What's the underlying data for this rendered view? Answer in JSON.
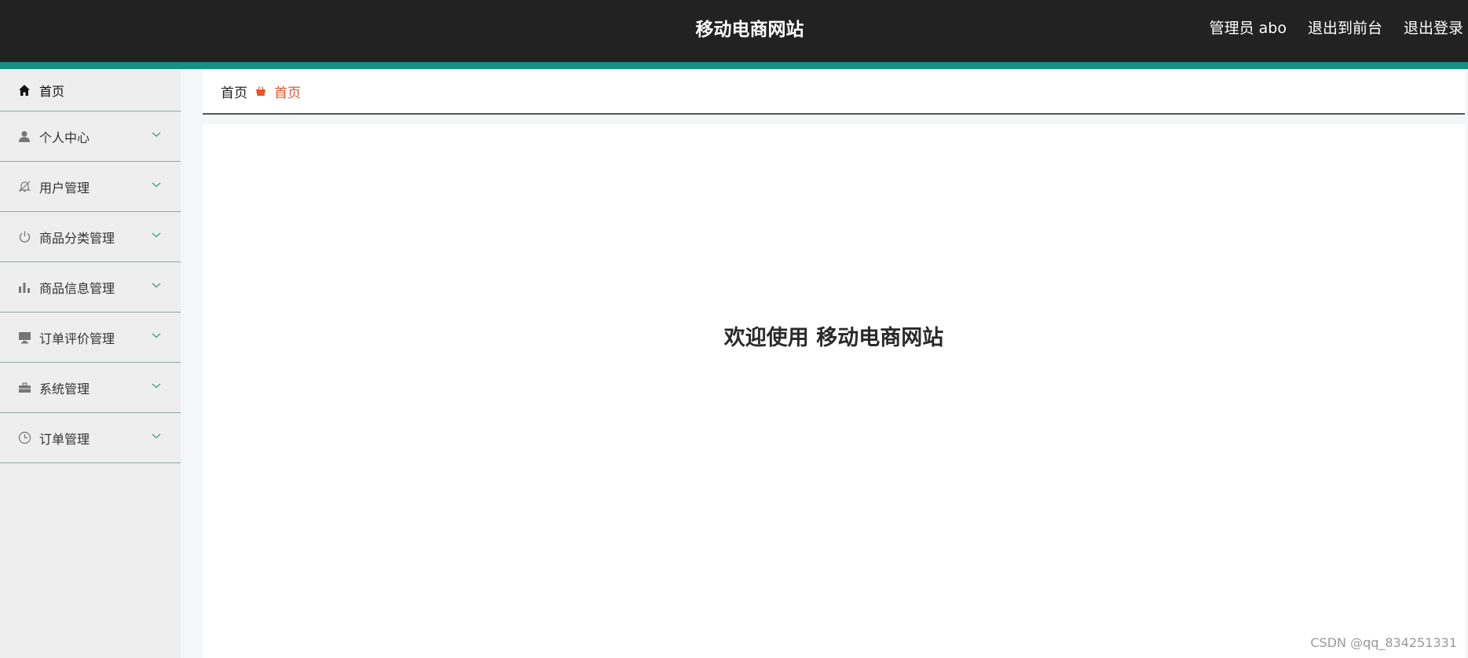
{
  "header": {
    "title": "移动电商网站",
    "admin_label": "管理员 abo",
    "back_to_front": "退出到前台",
    "logout": "退出登录"
  },
  "sidebar": {
    "items": [
      {
        "label": "首页",
        "icon": "home-icon",
        "expandable": false
      },
      {
        "label": "个人中心",
        "icon": "user-icon",
        "expandable": true
      },
      {
        "label": "用户管理",
        "icon": "bell-off-icon",
        "expandable": true
      },
      {
        "label": "商品分类管理",
        "icon": "power-icon",
        "expandable": true
      },
      {
        "label": "商品信息管理",
        "icon": "bar-chart-icon",
        "expandable": true
      },
      {
        "label": "订单评价管理",
        "icon": "monitor-icon",
        "expandable": true
      },
      {
        "label": "系统管理",
        "icon": "briefcase-icon",
        "expandable": true
      },
      {
        "label": "订单管理",
        "icon": "clock-icon",
        "expandable": true
      }
    ]
  },
  "breadcrumb": {
    "home": "首页",
    "current": "首页",
    "separator_icon": "basket-icon"
  },
  "main": {
    "welcome": "欢迎使用 移动电商网站"
  },
  "watermark": "CSDN @qq_834251331",
  "colors": {
    "topbar": "#222222",
    "accent": "#168f84",
    "breadcrumb_current": "#e8542a",
    "sidebar_bg": "#eeeeee"
  }
}
